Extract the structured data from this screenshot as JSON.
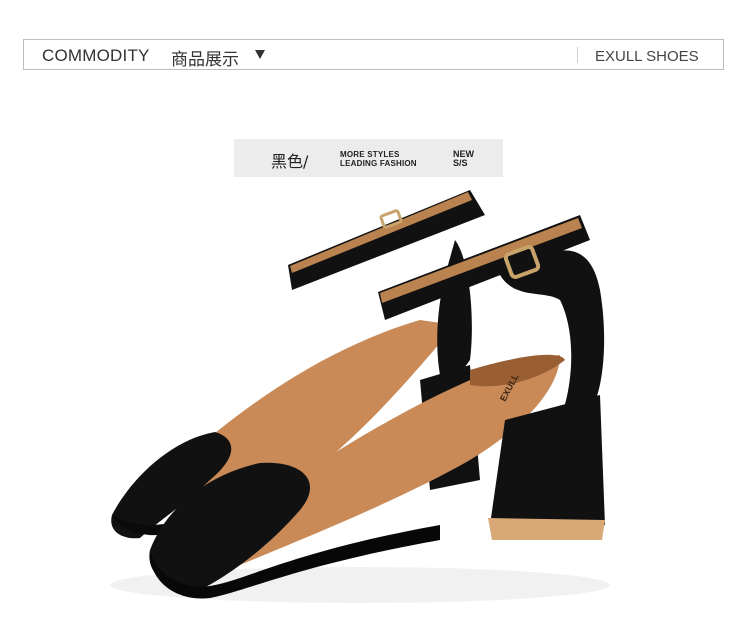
{
  "header": {
    "title_en": "COMMODITY",
    "title_cn": "商品展示",
    "dropdown_icon": "triangle-down-icon",
    "brand": "EXULL SHOES"
  },
  "tag": {
    "color_label": "黑色/",
    "line1": "MORE STYLES",
    "line2": "LEADING FASHION",
    "new_line1": "NEW",
    "new_line2": "S/S"
  },
  "product": {
    "insole_brand": "EXULL",
    "colors": {
      "suede": "#111111",
      "lining": "#c98a57",
      "lining_dark": "#9a5e33",
      "heel_tip": "#d9a877",
      "buckle": "#c8a46a"
    }
  }
}
